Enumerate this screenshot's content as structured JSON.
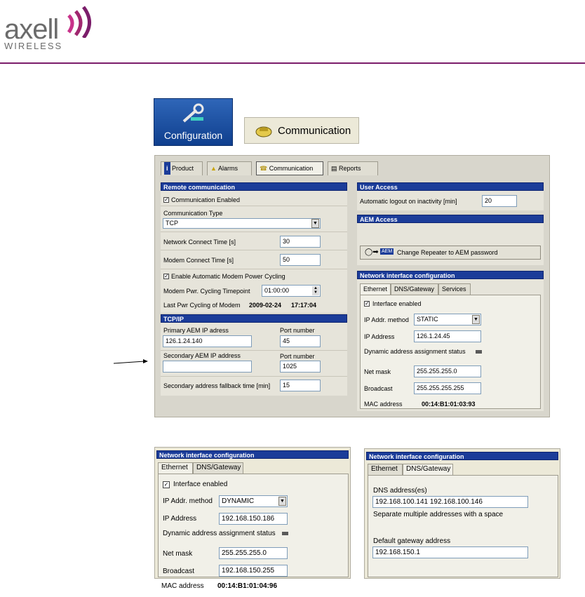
{
  "header": {
    "brand": "axell",
    "brand_sub": "WIRELESS",
    "rule_color": "#7b1d6a"
  },
  "toolbar": {
    "configuration_label": "Configuration",
    "communication_label": "Communication"
  },
  "main_window": {
    "tabs": [
      {
        "label": "Product",
        "icon": "info-icon"
      },
      {
        "label": "Alarms",
        "icon": "alarm-icon"
      },
      {
        "label": "Communication",
        "icon": "phone-icon"
      },
      {
        "label": "Reports",
        "icon": "report-icon"
      }
    ],
    "remote": {
      "title": "Remote communication",
      "comm_enabled_label": "Communication Enabled",
      "comm_enabled": true,
      "comm_type_label": "Communication Type",
      "comm_type_value": "TCP",
      "network_connect_label": "Network Connect Time [s]",
      "network_connect_value": "30",
      "modem_connect_label": "Modem Connect Time [s]",
      "modem_connect_value": "50",
      "auto_cycle_label": "Enable Automatic Modem Power Cycling",
      "auto_cycle": true,
      "cycle_timepoint_label": "Modem Pwr. Cycling Timepoint",
      "cycle_timepoint_value": "01:00:00",
      "last_cycle_label": "Last Pwr Cycling of Modem",
      "last_cycle_date": "2009-02-24",
      "last_cycle_time": "17:17:04"
    },
    "tcpip": {
      "title": "TCP/IP",
      "primary_label": "Primary AEM IP adress",
      "primary_value": "126.1.24.140",
      "primary_port_label": "Port number",
      "primary_port_value": "45",
      "secondary_label": "Secondary AEM IP address",
      "secondary_value": "",
      "secondary_port_label": "Port number",
      "secondary_port_value": "1025",
      "fallback_label": "Secondary address fallback time [min]",
      "fallback_value": "15"
    },
    "user_access": {
      "title": "User Access",
      "logout_label": "Automatic logout on inactivity [min]",
      "logout_value": "20"
    },
    "aem_access": {
      "title": "AEM Access",
      "button_label": "Change Repeater to AEM password",
      "aem_badge": "AEM"
    },
    "network": {
      "title": "Network interface configuration",
      "tabs": [
        "Ethernet",
        "DNS/Gateway",
        "Services"
      ],
      "interface_enabled_label": "Interface enabled",
      "method_label": "IP Addr. method",
      "method_value": "STATIC",
      "ip_label": "IP Address",
      "ip_value": "126.1.24.45",
      "dyn_status_label": "Dynamic address assignment status",
      "netmask_label": "Net mask",
      "netmask_value": "255.255.255.0",
      "broadcast_label": "Broadcast",
      "broadcast_value": "255.255.255.255",
      "mac_label": "MAC address",
      "mac_value": "00:14:B1:01:03:93"
    }
  },
  "lower_left": {
    "title": "Network interface configuration",
    "tabs": [
      "Ethernet",
      "DNS/Gateway"
    ],
    "interface_enabled_label": "Interface enabled",
    "method_label": "IP Addr. method",
    "method_value": "DYNAMIC",
    "ip_label": "IP Address",
    "ip_value": "192.168.150.186",
    "dyn_status_label": "Dynamic address assignment status",
    "netmask_label": "Net mask",
    "netmask_value": "255.255.255.0",
    "broadcast_label": "Broadcast",
    "broadcast_value": "192.168.150.255",
    "mac_label": "MAC address",
    "mac_value": "00:14:B1:01:04:96"
  },
  "lower_right": {
    "title": "Network interface configuration",
    "tabs": [
      "Ethernet",
      "DNS/Gateway"
    ],
    "dns_label": "DNS address(es)",
    "dns_value": "192.168.100.141 192.168.100.146",
    "dns_hint": "Separate multiple addresses with a space",
    "gateway_label": "Default gateway address",
    "gateway_value": "192.168.150.1"
  }
}
